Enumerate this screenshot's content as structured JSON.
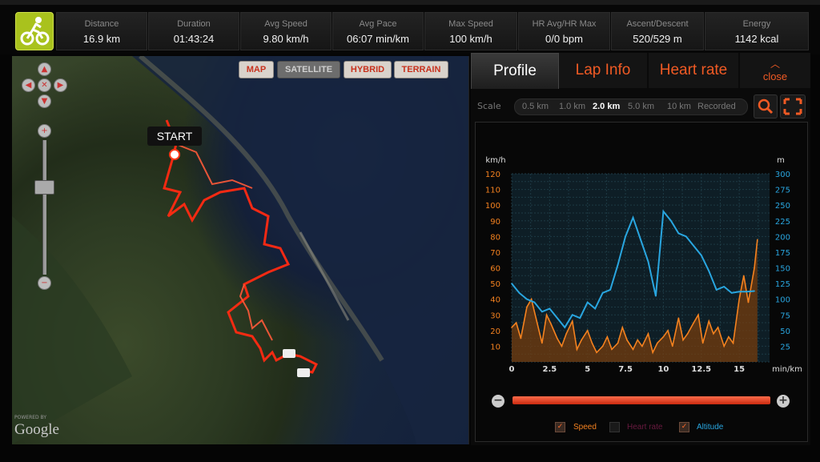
{
  "stats": [
    {
      "label": "Distance",
      "value": "16.9 km"
    },
    {
      "label": "Duration",
      "value": "01:43:24"
    },
    {
      "label": "Avg Speed",
      "value": "9.80 km/h"
    },
    {
      "label": "Avg Pace",
      "value": "06:07 min/km"
    },
    {
      "label": "Max Speed",
      "value": "100 km/h"
    },
    {
      "label": "HR Avg/HR Max",
      "value": "0/0 bpm"
    },
    {
      "label": "Ascent/Descent",
      "value": "520/529 m"
    },
    {
      "label": "Energy",
      "value": "1142 kcal"
    }
  ],
  "sport_icon": "cycling-icon",
  "map": {
    "types": [
      "MAP",
      "SATELLITE",
      "HYBRID",
      "TERRAIN"
    ],
    "active_type": "SATELLITE",
    "start_label": "START",
    "powered_by": "POWERED BY",
    "google": "Google",
    "nav": {
      "up": "up-arrow-icon",
      "down": "down-arrow-icon",
      "left": "left-arrow-icon",
      "right": "right-arrow-icon",
      "center": "center-icon",
      "zoom_in": "+",
      "zoom_out": "−"
    }
  },
  "panel": {
    "tabs": {
      "profile": "Profile",
      "lap": "Lap Info",
      "hr": "Heart rate",
      "close": "close"
    },
    "active_tab": "Profile",
    "scale_label": "Scale",
    "scales": [
      "0.5 km",
      "1.0 km",
      "2.0 km",
      "5.0 km",
      "10 km",
      "Recorded"
    ],
    "active_scale": "2.0 km",
    "legend": {
      "speed": "Speed",
      "hr": "Heart rate",
      "altitude": "Altitude"
    },
    "legend_checked": {
      "speed": true,
      "hr": false,
      "altitude": true
    },
    "colors": {
      "speed": "#f5821f",
      "altitude": "#29a6e0",
      "hr": "#c0207a",
      "accent": "#f05a24"
    }
  },
  "chart_data": {
    "type": "line",
    "y_left_label": "km/h",
    "y_right_label": "m",
    "x_unit_label": "min/km",
    "x_ticks": [
      "0",
      "2.5",
      "5",
      "7.5",
      "10",
      "12.5",
      "15"
    ],
    "y_left_ticks": [
      "10",
      "20",
      "30",
      "40",
      "50",
      "60",
      "70",
      "80",
      "90",
      "100",
      "110",
      "120"
    ],
    "y_right_ticks": [
      "25",
      "50",
      "75",
      "100",
      "125",
      "150",
      "175",
      "200",
      "225",
      "250",
      "275",
      "300"
    ],
    "xlim": [
      0,
      17
    ],
    "ylim_left": [
      0,
      120
    ],
    "ylim_right": [
      0,
      300
    ],
    "grid": true,
    "series": [
      {
        "name": "Altitude",
        "axis": "right",
        "x": [
          0,
          0.5,
          1,
          1.5,
          2,
          2.5,
          3,
          3.5,
          4,
          4.5,
          5,
          5.5,
          6,
          6.5,
          7,
          7.5,
          8,
          8.5,
          9,
          9.5,
          10,
          10.5,
          11,
          11.5,
          12,
          12.5,
          13,
          13.5,
          14,
          14.5,
          15,
          15.5,
          16
        ],
        "y": [
          125,
          110,
          100,
          95,
          80,
          85,
          70,
          55,
          75,
          70,
          95,
          85,
          110,
          115,
          155,
          200,
          230,
          195,
          160,
          105,
          240,
          225,
          205,
          200,
          185,
          170,
          145,
          115,
          120,
          110,
          112,
          112,
          113
        ]
      },
      {
        "name": "Speed",
        "axis": "left",
        "x": [
          0,
          0.3,
          0.6,
          1,
          1.3,
          1.6,
          2,
          2.3,
          2.6,
          3,
          3.3,
          3.6,
          4,
          4.3,
          4.6,
          5,
          5.3,
          5.6,
          6,
          6.3,
          6.6,
          7,
          7.3,
          7.6,
          8,
          8.3,
          8.6,
          9,
          9.3,
          9.6,
          10,
          10.3,
          10.6,
          11,
          11.3,
          11.6,
          12,
          12.3,
          12.6,
          13,
          13.3,
          13.6,
          14,
          14.3,
          14.6,
          15,
          15.3,
          15.6,
          16,
          16.2
        ],
        "y": [
          22,
          25,
          15,
          35,
          40,
          28,
          12,
          30,
          24,
          15,
          10,
          18,
          26,
          8,
          14,
          20,
          12,
          6,
          10,
          16,
          8,
          12,
          22,
          14,
          8,
          14,
          10,
          18,
          6,
          12,
          16,
          20,
          10,
          28,
          14,
          18,
          25,
          30,
          12,
          26,
          18,
          22,
          10,
          16,
          12,
          40,
          55,
          38,
          60,
          78
        ]
      }
    ]
  }
}
